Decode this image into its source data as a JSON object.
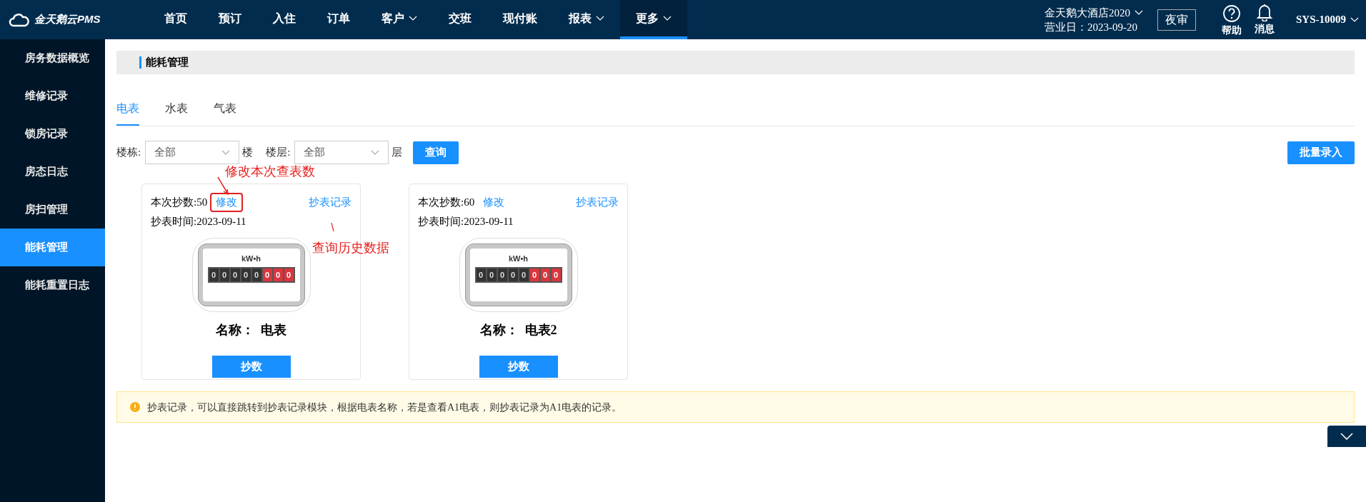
{
  "topbar": {
    "logo": "金天鹅云PMS",
    "nav": [
      {
        "label": "首页",
        "dropdown": false,
        "selected": false
      },
      {
        "label": "预订",
        "dropdown": false,
        "selected": false
      },
      {
        "label": "入住",
        "dropdown": false,
        "selected": false
      },
      {
        "label": "订单",
        "dropdown": false,
        "selected": false
      },
      {
        "label": "客户",
        "dropdown": true,
        "selected": false
      },
      {
        "label": "交班",
        "dropdown": false,
        "selected": false
      },
      {
        "label": "现付账",
        "dropdown": false,
        "selected": false
      },
      {
        "label": "报表",
        "dropdown": true,
        "selected": false
      },
      {
        "label": "更多",
        "dropdown": true,
        "selected": true
      }
    ],
    "hotel": "金天鹅大酒店2020",
    "business_day": "营业日：2023-09-20",
    "night_audit": "夜审",
    "help": "帮助",
    "messages": "消息",
    "user": "SYS-10009"
  },
  "sidebar": {
    "items": [
      {
        "label": "房务数据概览",
        "selected": false
      },
      {
        "label": "维修记录",
        "selected": false
      },
      {
        "label": "锁房记录",
        "selected": false
      },
      {
        "label": "房态日志",
        "selected": false
      },
      {
        "label": "房扫管理",
        "selected": false
      },
      {
        "label": "能耗管理",
        "selected": true
      },
      {
        "label": "能耗重置日志",
        "selected": false
      }
    ]
  },
  "page_title": "能耗管理",
  "tabs": [
    {
      "label": "电表",
      "selected": true
    },
    {
      "label": "水表",
      "selected": false
    },
    {
      "label": "气表",
      "selected": false
    }
  ],
  "filters": {
    "building_label": "楼栋:",
    "building_value": "全部",
    "building_suffix": "楼",
    "floor_label": "楼层:",
    "floor_value": "全部",
    "floor_suffix": "层",
    "query": "查询",
    "batch": "批量录入"
  },
  "cards": [
    {
      "reading": "本次抄数:50",
      "edit": "修改",
      "highlighted": true,
      "history": "抄表记录",
      "time": "抄表时间:2023-09-11",
      "unit": "kW•h",
      "digits": [
        {
          "digit": "0",
          "red": false
        },
        {
          "digit": "0",
          "red": false
        },
        {
          "digit": "0",
          "red": false
        },
        {
          "digit": "0",
          "red": false
        },
        {
          "digit": "0",
          "red": false
        },
        {
          "digit": "0",
          "red": true
        },
        {
          "digit": "0",
          "red": true
        },
        {
          "digit": "0",
          "red": true
        }
      ],
      "name": "名称：  电表",
      "button": "抄数"
    },
    {
      "reading": "本次抄数:60",
      "edit": "修改",
      "highlighted": false,
      "history": "抄表记录",
      "time": "抄表时间:2023-09-11",
      "unit": "kW•h",
      "digits": [
        {
          "digit": "0",
          "red": false
        },
        {
          "digit": "0",
          "red": false
        },
        {
          "digit": "0",
          "red": false
        },
        {
          "digit": "0",
          "red": false
        },
        {
          "digit": "0",
          "red": false
        },
        {
          "digit": "0",
          "red": true
        },
        {
          "digit": "0",
          "red": true
        },
        {
          "digit": "0",
          "red": true
        }
      ],
      "name": "名称：  电表2",
      "button": "抄数"
    }
  ],
  "annotations": [
    "修改本次查表数",
    "查询历史数据"
  ],
  "notice": "抄表记录，可以直接跳转到抄表记录模块，根据电表名称，若是查看A1电表，则抄表记录为A1电表的记录。"
}
